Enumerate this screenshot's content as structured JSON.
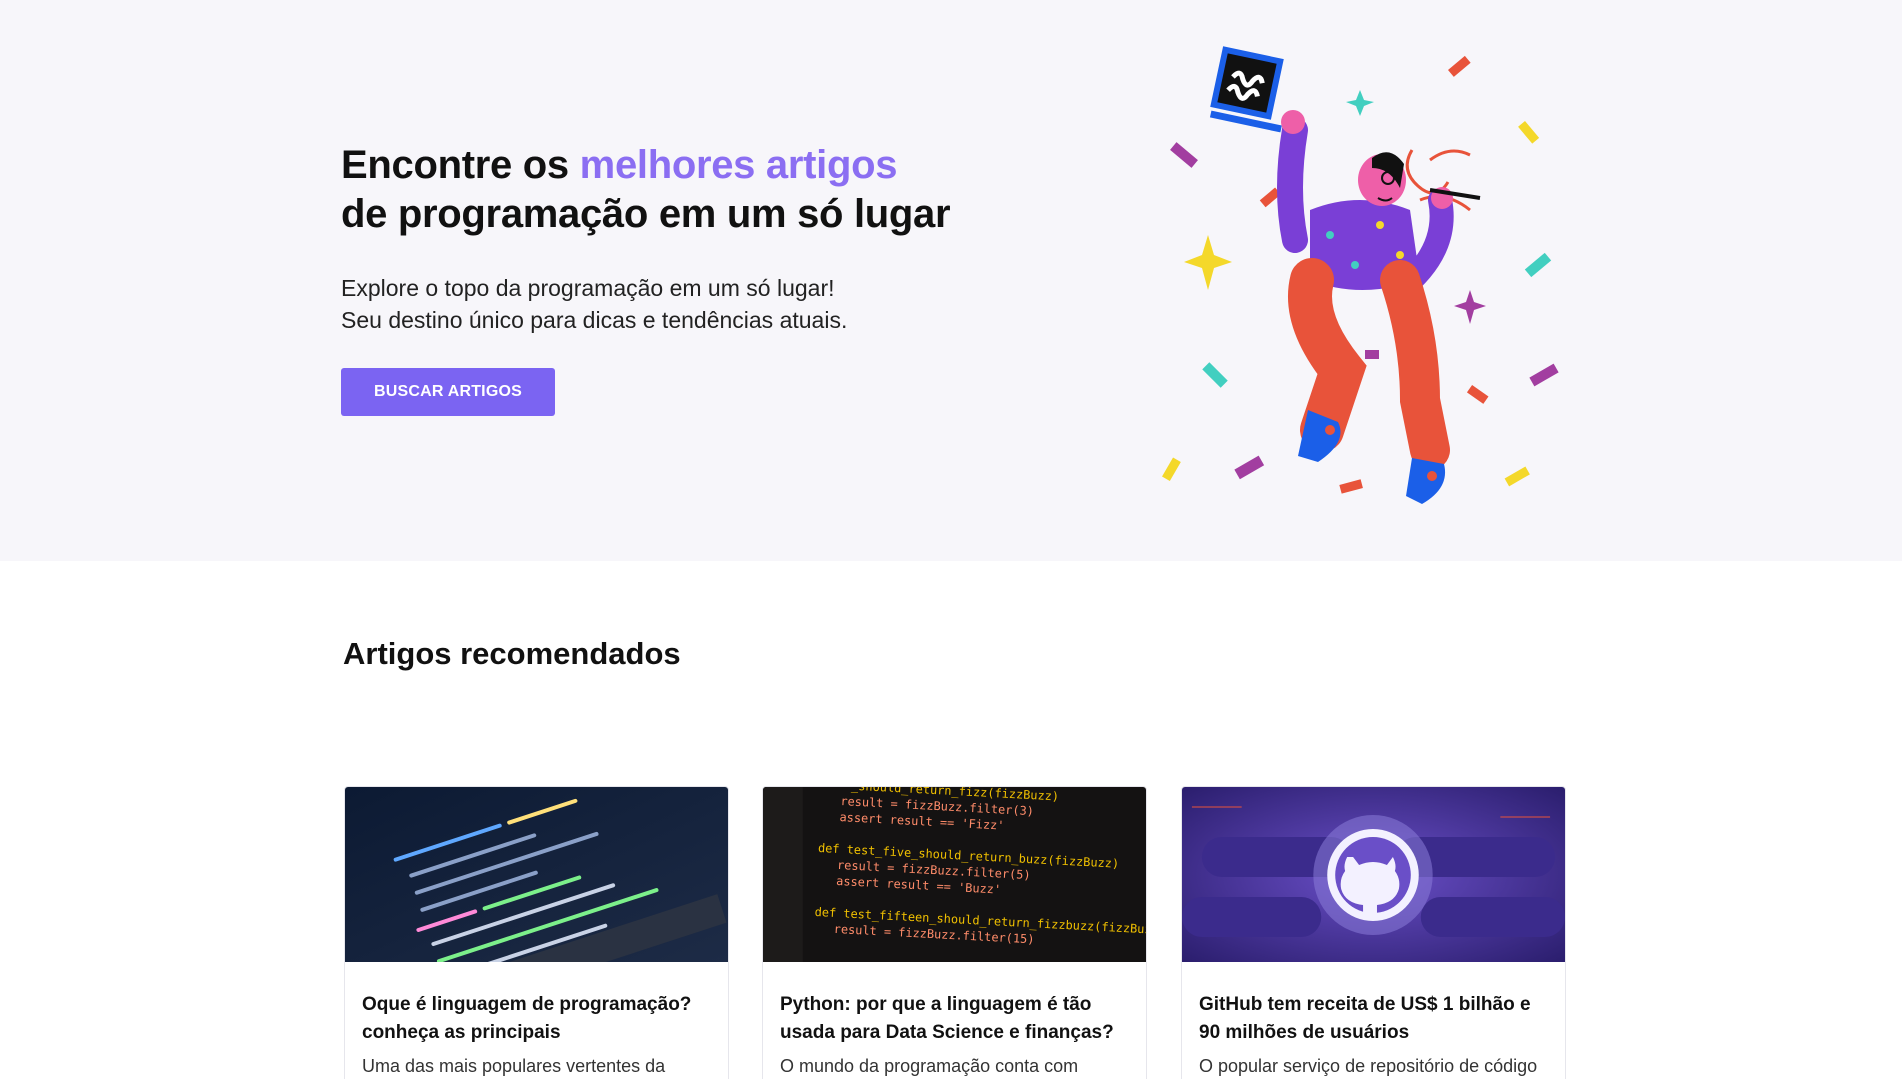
{
  "hero": {
    "title_part1": "Encontre os ",
    "title_accent": "melhores artigos",
    "title_part2": "de programação em um só lugar",
    "subtitle_line1": "Explore o topo da programação em um só lugar!",
    "subtitle_line2": "Seu destino único para dicas e tendências atuais.",
    "button_label": "BUSCAR ARTIGOS"
  },
  "colors": {
    "accent": "#8b6ef2",
    "button": "#7b64f2",
    "hero_bg": "#f7f6fa"
  },
  "section": {
    "title": "Artigos recomendados"
  },
  "articles": [
    {
      "title": "Oque é linguagem de programação? conheça as principais",
      "description": "Uma das mais populares vertentes da",
      "image": "code-on-laptop-image"
    },
    {
      "title": "Python: por que a linguagem é tão usada para Data Science e finanças?",
      "description": "O mundo da programação conta com",
      "image": "python-code-image"
    },
    {
      "title": "GitHub tem receita de US$ 1 bilhão e 90 milhões de usuários",
      "description": "O popular serviço de repositório de código",
      "image": "github-logo-image"
    }
  ],
  "code_snippets": {
    "line1": "_should_return_fizz(fizzBuzz)",
    "line2": "result = fizzBuzz.filter(3)",
    "line3": "assert result == 'Fizz'",
    "line4": "def test_five_should_return_buzz(fizzBuzz)",
    "line5": "result = fizzBuzz.filter(5)",
    "line6": "assert result == 'Buzz'",
    "line7": "def test_fifteen_should_return_fizzbuzz(fizzBuzz)",
    "line8": "result = fizzBuzz.filter(15)"
  }
}
